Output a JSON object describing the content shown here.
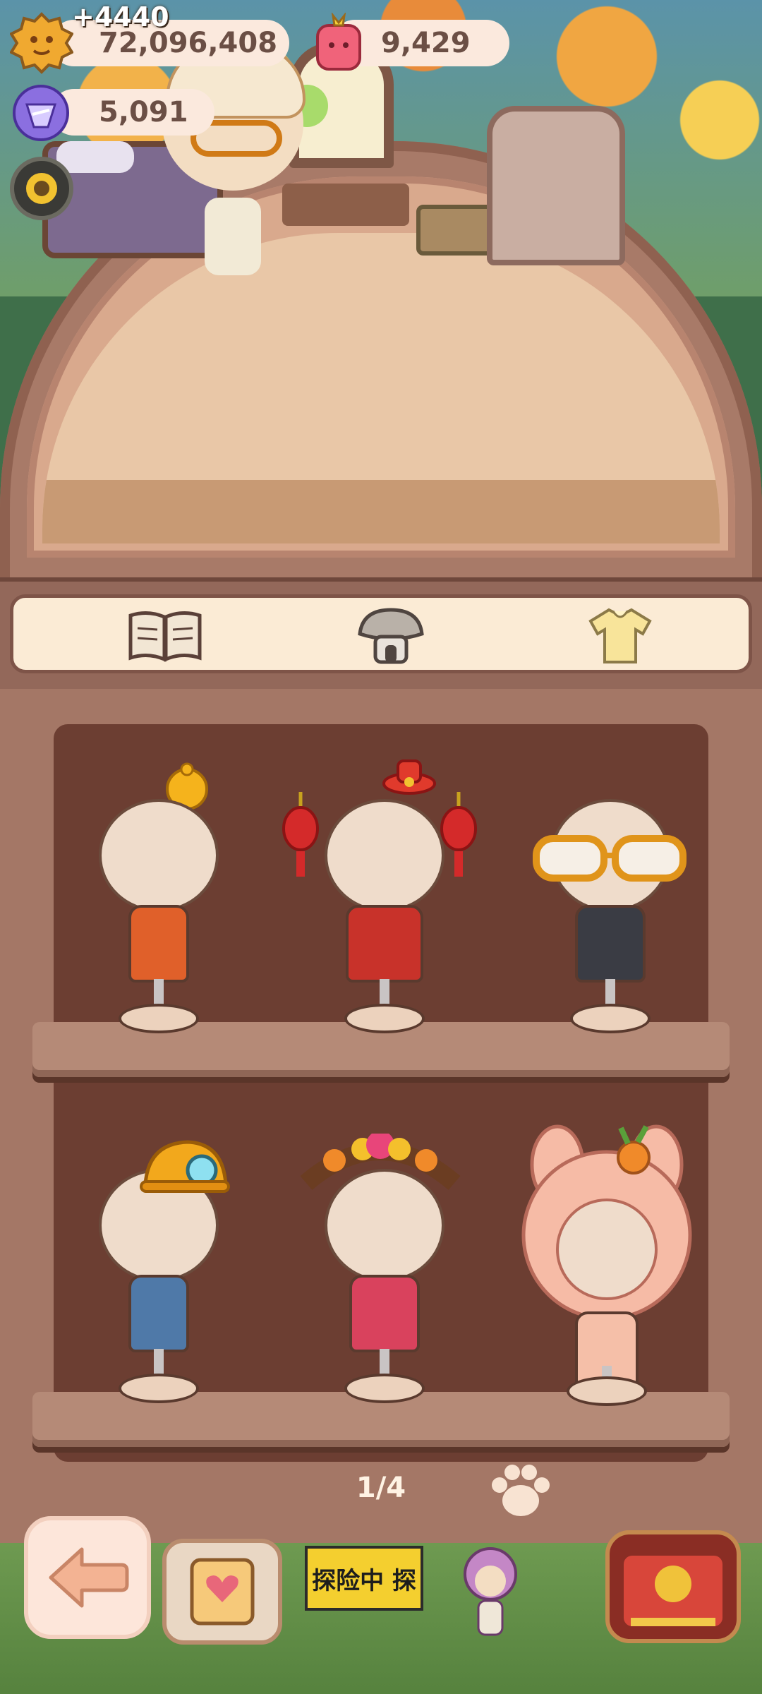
{
  "currency": {
    "gold": "72,096,408",
    "gold_gain": "+4440",
    "ruby": "9,429",
    "gem": "5,091"
  },
  "tabs": [
    {
      "name": "book",
      "icon": "open-book-icon",
      "active": false
    },
    {
      "name": "house",
      "icon": "mushroom-house-icon",
      "active": false
    },
    {
      "name": "outfits",
      "icon": "shirt-icon",
      "active": true
    }
  ],
  "outfits": [
    {
      "id": "explorer-vest",
      "accessory": "yellow-beanie-icon",
      "torso_color": "#e0602a"
    },
    {
      "id": "lunar-new-year",
      "accessory": "red-lanterns-icon",
      "torso_color": "#c8322a"
    },
    {
      "id": "business-suit",
      "accessory": "orange-glasses-icon",
      "torso_color": "#3a3c44"
    },
    {
      "id": "miner-overalls",
      "accessory": "miner-helmet-icon",
      "torso_color": "#4f79a8"
    },
    {
      "id": "flower-crown",
      "accessory": "flower-crown-icon",
      "torso_color": "#d9425d"
    },
    {
      "id": "bunny-costume",
      "accessory": "bunny-hood-icon",
      "torso_color": "#f5bfa8"
    }
  ],
  "pagination": {
    "label": "1/4",
    "current": 1,
    "total": 4
  },
  "bottom_nav": {
    "banner_text": "探险中 探"
  },
  "colors": {
    "wardrobe": "#a47766",
    "closet_back": "#6c3e32",
    "tab_bg": "#fbebd5",
    "pill_bg": "#fbe9dd"
  }
}
